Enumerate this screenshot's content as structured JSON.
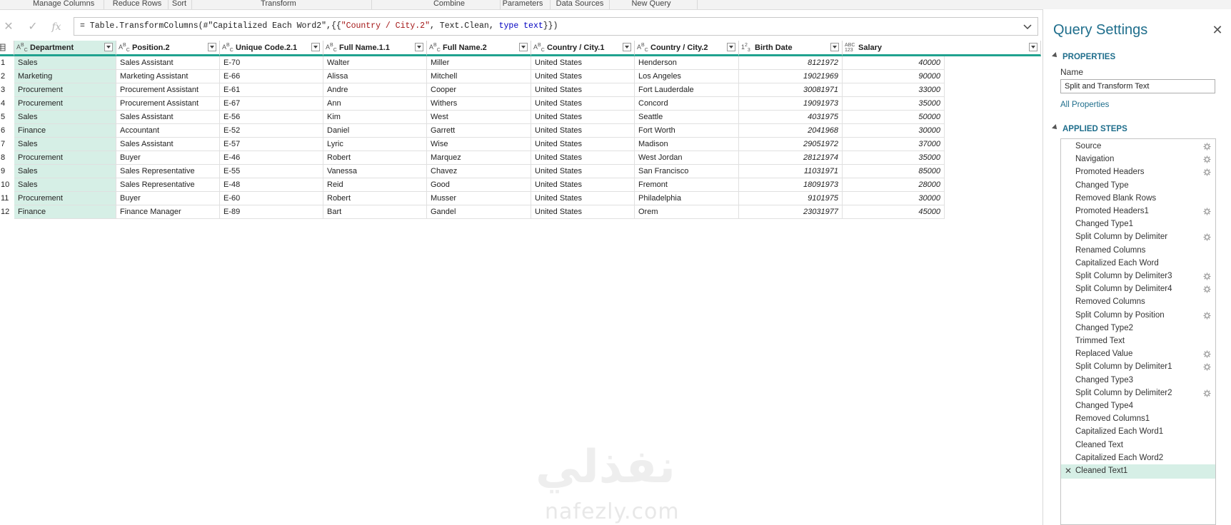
{
  "ribbon": {
    "groups": [
      "Manage Columns",
      "Reduce Rows",
      "Sort",
      "Transform",
      "Combine",
      "Parameters",
      "Data Sources",
      "New Query"
    ]
  },
  "formula_bar": {
    "icons": [
      "close-icon",
      "check-icon",
      "fx-icon"
    ],
    "cancel_glyph": "✕",
    "accept_glyph": "✓",
    "fx_glyph": "fx",
    "formula_parts": {
      "p1": "= Table.TransformColumns(#\"Capitalized Each Word2\",{{",
      "p2": "\"Country / City.2\"",
      "p3": ", Text.Clean, ",
      "p4": "type",
      "p5": " ",
      "p6": "text",
      "p7": "}})"
    }
  },
  "grid": {
    "columns": [
      {
        "label": "Department",
        "type_icon": "ABC"
      },
      {
        "label": "Position.2",
        "type_icon": "ABC"
      },
      {
        "label": "Unique Code.2.1",
        "type_icon": "ABC"
      },
      {
        "label": "Full Name.1.1",
        "type_icon": "ABC"
      },
      {
        "label": "Full Name.2",
        "type_icon": "ABC"
      },
      {
        "label": "Country / City.1",
        "type_icon": "ABC"
      },
      {
        "label": "Country / City.2",
        "type_icon": "ABC"
      },
      {
        "label": "Birth Date",
        "type_icon": "123"
      },
      {
        "label": "Salary",
        "type_icon": "ABC123"
      }
    ],
    "rows": [
      [
        "1",
        "Sales",
        "Sales Assistant",
        "E-70",
        "Walter",
        "Miller",
        "United States",
        "Henderson",
        "8121972",
        "40000"
      ],
      [
        "2",
        "Marketing",
        "Marketing Assistant",
        "E-66",
        "Alissa",
        "Mitchell",
        "United States",
        "Los Angeles",
        "19021969",
        "90000"
      ],
      [
        "3",
        "Procurement",
        "Procurement Assistant",
        "E-61",
        "Andre",
        "Cooper",
        "United States",
        "Fort Lauderdale",
        "30081971",
        "33000"
      ],
      [
        "4",
        "Procurement",
        "Procurement Assistant",
        "E-67",
        "Ann",
        "Withers",
        "United States",
        "Concord",
        "19091973",
        "35000"
      ],
      [
        "5",
        "Sales",
        "Sales Assistant",
        "E-56",
        "Kim",
        "West",
        "United States",
        "Seattle",
        "4031975",
        "50000"
      ],
      [
        "6",
        "Finance",
        "Accountant",
        "E-52",
        "Daniel",
        "Garrett",
        "United States",
        "Fort Worth",
        "2041968",
        "30000"
      ],
      [
        "7",
        "Sales",
        "Sales Assistant",
        "E-57",
        "Lyric",
        "Wise",
        "United States",
        "Madison",
        "29051972",
        "37000"
      ],
      [
        "8",
        "Procurement",
        "Buyer",
        "E-46",
        "Robert",
        "Marquez",
        "United States",
        "West Jordan",
        "28121974",
        "35000"
      ],
      [
        "9",
        "Sales",
        "Sales Representative",
        "E-55",
        "Vanessa",
        "Chavez",
        "United States",
        "San Francisco",
        "11031971",
        "85000"
      ],
      [
        "10",
        "Sales",
        "Sales Representative",
        "E-48",
        "Reid",
        "Good",
        "United States",
        "Fremont",
        "18091973",
        "28000"
      ],
      [
        "11",
        "Procurement",
        "Buyer",
        "E-60",
        "Robert",
        "Musser",
        "United States",
        "Philadelphia",
        "9101975",
        "30000"
      ],
      [
        "12",
        "Finance",
        "Finance Manager",
        "E-89",
        "Bart",
        "Gandel",
        "United States",
        "Orem",
        "23031977",
        "45000"
      ]
    ]
  },
  "watermark": {
    "arabic": "نفذلي",
    "latin": "nafezly.com"
  },
  "query_settings": {
    "title": "Query Settings",
    "close_glyph": "✕",
    "properties_header": "PROPERTIES",
    "name_label": "Name",
    "name_value": "Split and Transform Text",
    "all_properties_link": "All Properties",
    "applied_steps_header": "APPLIED STEPS",
    "steps": [
      {
        "label": "Source",
        "gear": true
      },
      {
        "label": "Navigation",
        "gear": true
      },
      {
        "label": "Promoted Headers",
        "gear": true
      },
      {
        "label": "Changed Type",
        "gear": false
      },
      {
        "label": "Removed Blank Rows",
        "gear": false
      },
      {
        "label": "Promoted Headers1",
        "gear": true
      },
      {
        "label": "Changed Type1",
        "gear": false
      },
      {
        "label": "Split Column by Delimiter",
        "gear": true
      },
      {
        "label": "Renamed Columns",
        "gear": false
      },
      {
        "label": "Capitalized Each Word",
        "gear": false
      },
      {
        "label": "Split Column by Delimiter3",
        "gear": true
      },
      {
        "label": "Split Column by Delimiter4",
        "gear": true
      },
      {
        "label": "Removed Columns",
        "gear": false
      },
      {
        "label": "Split Column by Position",
        "gear": true
      },
      {
        "label": "Changed Type2",
        "gear": false
      },
      {
        "label": "Trimmed Text",
        "gear": false
      },
      {
        "label": "Replaced Value",
        "gear": true
      },
      {
        "label": "Split Column by Delimiter1",
        "gear": true
      },
      {
        "label": "Changed Type3",
        "gear": false
      },
      {
        "label": "Split Column by Delimiter2",
        "gear": true
      },
      {
        "label": "Changed Type4",
        "gear": false
      },
      {
        "label": "Removed Columns1",
        "gear": false
      },
      {
        "label": "Capitalized Each Word1",
        "gear": false
      },
      {
        "label": "Cleaned Text",
        "gear": false
      },
      {
        "label": "Capitalized Each Word2",
        "gear": false
      },
      {
        "label": "Cleaned Text1",
        "gear": false,
        "active": true
      }
    ],
    "active_step_icon_glyph": "✕"
  },
  "colors": {
    "accent": "#1fa28f",
    "selected_bg": "#d6efe6",
    "title_blue": "#1f6e8c"
  }
}
